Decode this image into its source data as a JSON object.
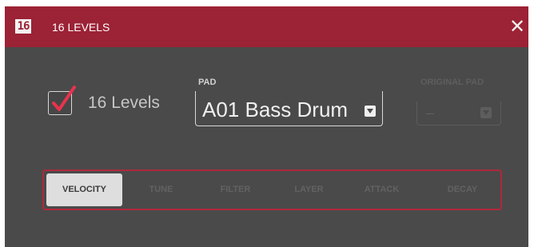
{
  "dialog": {
    "icon_text": "16",
    "title": "16 LEVELS",
    "close_glyph": "✕"
  },
  "sixteen_levels": {
    "label": "16 Levels",
    "checked": true,
    "check_color": "#e8334d"
  },
  "pad": {
    "label": "PAD",
    "value": "A01 Bass Drum"
  },
  "original_pad": {
    "label": "ORIGINAL PAD",
    "value": "–",
    "enabled": false
  },
  "tabs": [
    {
      "label": "VELOCITY",
      "active": true
    },
    {
      "label": "TUNE",
      "active": false
    },
    {
      "label": "FILTER",
      "active": false
    },
    {
      "label": "LAYER",
      "active": false
    },
    {
      "label": "ATTACK",
      "active": false
    },
    {
      "label": "DECAY",
      "active": false
    }
  ],
  "colors": {
    "title_bar": "#9c2235",
    "background": "#4a4a4a",
    "accent": "#b0283c"
  }
}
